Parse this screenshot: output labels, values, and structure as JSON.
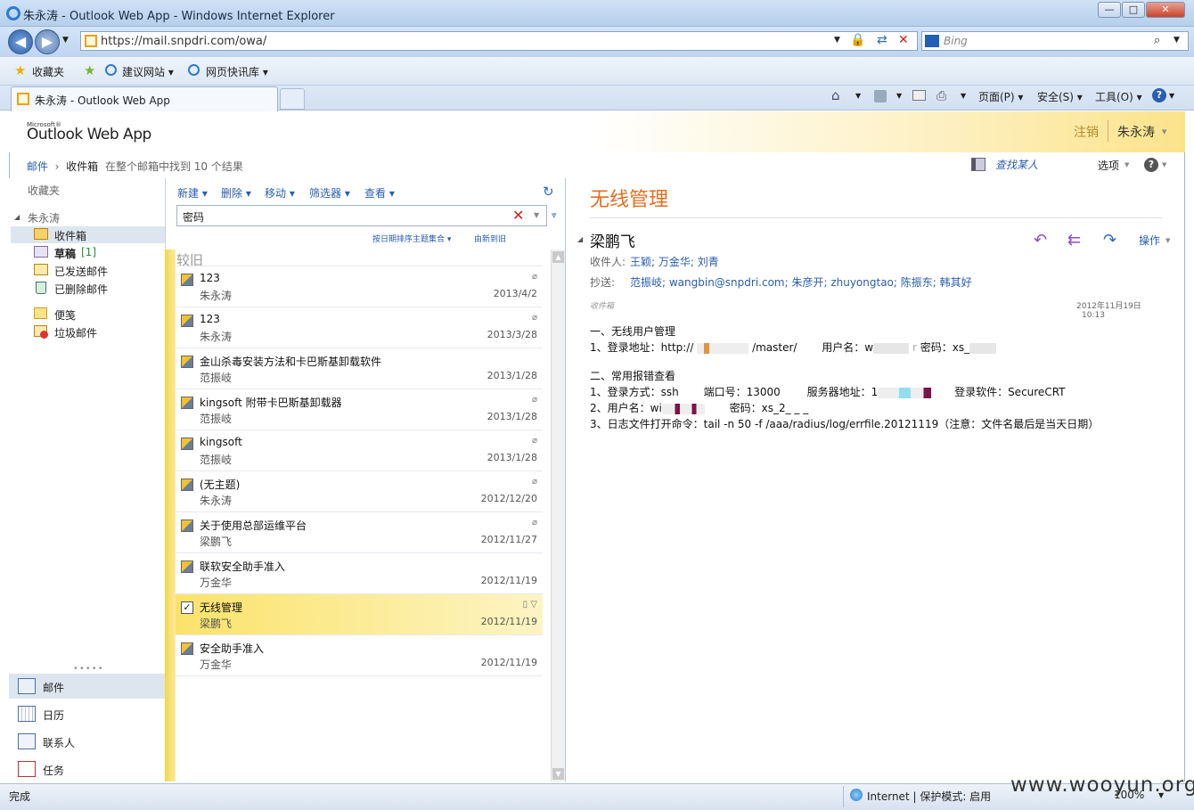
{
  "window": {
    "title": "朱永涛 - Outlook Web App - Windows Internet Explorer"
  },
  "browser": {
    "url": "https://mail.snpdri.com/owa/",
    "search_placeholder": "Bing",
    "favorites": "收藏夹",
    "fav_items": [
      "建议网站 ▾",
      "网页快讯库 ▾"
    ],
    "tab_title": "朱永涛 - Outlook Web App",
    "commands": [
      "页面(P) ▾",
      "安全(S) ▾",
      "工具(O) ▾"
    ],
    "status": "完成",
    "zone": "Internet | 保护模式: 启用",
    "zoom": "100%"
  },
  "owa": {
    "logo_ms": "Microsoft®",
    "logo": "Outlook Web App",
    "signout": "注销",
    "user": "朱永涛",
    "breadcrumb": {
      "root": "邮件",
      "folder": "收件箱",
      "info": "在整个邮箱中找到 10 个结果"
    },
    "find_people": "查找某人",
    "options": "选项",
    "help": "?"
  },
  "leftnav": {
    "favorites": "收藏夹",
    "mailbox": "朱永涛",
    "folders": [
      {
        "label": "收件箱",
        "count": ""
      },
      {
        "label": "草稿",
        "count": "[1]"
      },
      {
        "label": "已发送邮件",
        "count": ""
      },
      {
        "label": "已删除邮件",
        "count": ""
      },
      {
        "label": "便笺",
        "count": ""
      },
      {
        "label": "垃圾邮件",
        "count": ""
      }
    ],
    "bottom": [
      "邮件",
      "日历",
      "联系人",
      "任务"
    ]
  },
  "list": {
    "toolbar": [
      "新建 ▾",
      "删除 ▾",
      "移动 ▾",
      "筛选器 ▾",
      "查看 ▾"
    ],
    "search_value": "密码",
    "sort_label": "按日期排序主题集合 ▾",
    "order_label": "由新到旧",
    "group": "较旧",
    "messages": [
      {
        "subject": "123",
        "from": "朱永涛",
        "date": "2013/4/2",
        "attach": true
      },
      {
        "subject": "123",
        "from": "朱永涛",
        "date": "2013/3/28",
        "attach": true
      },
      {
        "subject": "金山杀毒安装方法和卡巴斯基卸载软件",
        "from": "范振岐",
        "date": "2013/1/28",
        "attach": false
      },
      {
        "subject": "kingsoft 附带卡巴斯基卸载器",
        "from": "范振岐",
        "date": "2013/1/28",
        "attach": true
      },
      {
        "subject": "kingsoft",
        "from": "范振岐",
        "date": "2013/1/28",
        "attach": true
      },
      {
        "subject": "(无主题)",
        "from": "朱永涛",
        "date": "2012/12/20",
        "attach": true
      },
      {
        "subject": "关于使用总部运维平台",
        "from": "梁鹏飞",
        "date": "2012/11/27",
        "attach": true
      },
      {
        "subject": "联软安全助手准入",
        "from": "万金华",
        "date": "2012/11/19",
        "attach": false
      },
      {
        "subject": "无线管理",
        "from": "梁鹏飞",
        "date": "2012/11/19",
        "attach": false
      },
      {
        "subject": "安全助手准入",
        "from": "万金华",
        "date": "2012/11/19",
        "attach": false
      }
    ]
  },
  "reading": {
    "subject": "无线管理",
    "sender": "梁鹏飞",
    "actions": "操作",
    "to_label": "收件人:",
    "to": "王颖; 万金华; 刘青",
    "cc_label": "抄送:",
    "cc": "范振岐; wangbin@snpdri.com; 朱彦开; zhuyongtao; 陈振东; 韩其好",
    "folder": "收件箱",
    "date": "2012年11月19日",
    "time": "10:13",
    "body": {
      "s1_title": "一、无线用户管理",
      "s1_line": [
        "1、登录地址：http://",
        "/master/",
        "用户名：w",
        "r",
        "密码：xs_"
      ],
      "s2_title": "二、常用报错查看",
      "s2_line1": [
        "1、登录方式：ssh",
        "端口号：13000",
        "服务器地址：1",
        "登录软件：SecureCRT"
      ],
      "s2_line2": [
        "2、用户名：wi",
        "密码：xs_2_ _ _"
      ],
      "s2_line3": "3、日志文件打开命令：tail -n 50 -f /aaa/radius/log/errfile.20121119（注意：文件名最后是当天日期）"
    }
  },
  "watermark": "www.wooyun.org",
  "colors": {
    "accent": "#e36d20",
    "link": "#2a5db0",
    "selected": "#fbe36a"
  }
}
